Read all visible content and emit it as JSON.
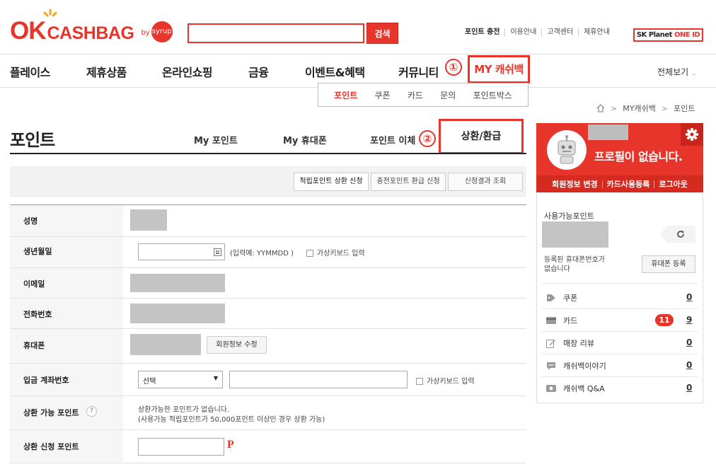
{
  "header": {
    "logo_ok": "OK",
    "logo_cashbag": "CASHBAG",
    "logo_by": "by",
    "logo_syrup": "syrup",
    "search_placeholder": "",
    "search_button": "검색",
    "util_links": [
      "포인트 충전",
      "이용안내",
      "고객센터",
      "제휴안내"
    ],
    "sk_planet_part1": "SK Planet",
    "sk_planet_part2": "ONE ID"
  },
  "nav": {
    "items": [
      "플레이스",
      "제휴상품",
      "온라인쇼핑",
      "금융",
      "이벤트&혜택",
      "커뮤니티"
    ],
    "my_cashbag": "MY 캐쉬백",
    "view_all": "전체보기",
    "annotation_1": "①",
    "annotation_2": "②"
  },
  "submenu": [
    "포인트",
    "쿠폰",
    "카드",
    "문의",
    "포인트박스"
  ],
  "breadcrumb": [
    "MY캐쉬백",
    "포인트"
  ],
  "page": {
    "title": "포인트",
    "tabs": [
      "My 포인트",
      "My 휴대폰",
      "포인트 이체",
      "상환/환급"
    ]
  },
  "subtabs": [
    "적립포인트 상환 신청",
    "충전포인트 환급 신청",
    "신청결과 조회"
  ],
  "form": {
    "name_label": "성명",
    "birth_label": "생년월일",
    "birth_hint": "(입력예: YYMMDD )",
    "virtual_keyboard": "가상키보드 입력",
    "email_label": "이메일",
    "phone_label": "전화번호",
    "mobile_label": "휴대폰",
    "edit_member_button": "회원정보 수정",
    "account_label": "입금 계좌번호",
    "bank_select": "선택",
    "available_label": "상환 가능 포인트",
    "help_icon_text": "?",
    "available_note_1": "상환가능한 포인트가 없습니다.",
    "available_note_2": "(사용가능 적립포인트가 50,000포인트 이상인 경우 상환 가능)",
    "request_label": "상환 신청 포인트",
    "point_unit": "P"
  },
  "profile": {
    "no_profile": "프로필이 없습니다.",
    "links": [
      "회원정보 변경",
      "카드사용등록",
      "로그아웃"
    ],
    "available_points_label": "사용가능포인트",
    "no_phone_line1": "등록된 휴대폰번호가",
    "no_phone_line2": "없습니다",
    "phone_register_button": "휴대폰 등록",
    "items": [
      {
        "label": "쿠폰",
        "count": "0"
      },
      {
        "label": "카드",
        "count": "9",
        "badge": "11"
      },
      {
        "label": "매장 리뷰",
        "count": "0"
      },
      {
        "label": "캐쉬백이야기",
        "count": "0"
      },
      {
        "label": "캐쉬백 Q&A",
        "count": "0"
      }
    ]
  },
  "colors": {
    "brand": "#e8352b"
  }
}
